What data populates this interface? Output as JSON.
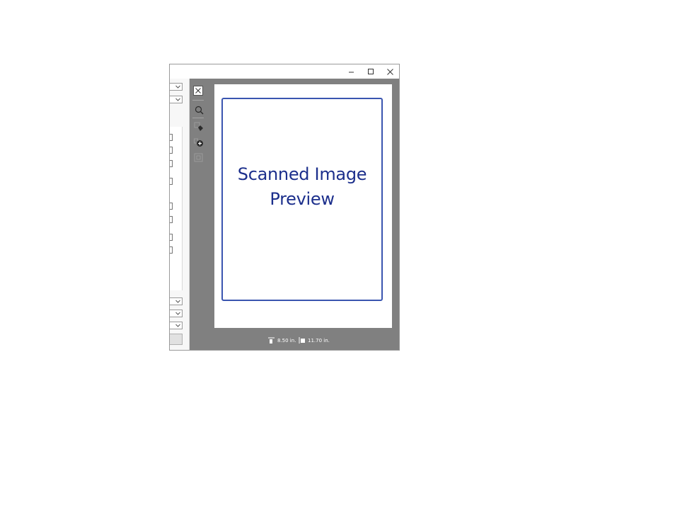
{
  "window": {
    "controls": {
      "minimize_icon": "minimize-icon",
      "maximize_icon": "maximize-icon",
      "close_icon": "close-icon"
    }
  },
  "toolbar": {
    "tools": [
      "close-preview-icon",
      "zoom-icon",
      "auto-locate-icon",
      "add-area-icon",
      "delete-area-icon"
    ]
  },
  "preview": {
    "line1": "Scanned Image",
    "line2": "Preview"
  },
  "dimensions": {
    "width": "8.50 in.",
    "height": "11.70 in."
  },
  "colors": {
    "preview_text": "#1c2f8c",
    "frame": "#3a55b0",
    "background_gray": "#808080"
  }
}
